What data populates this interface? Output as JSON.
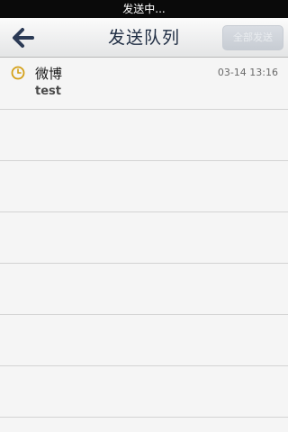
{
  "status_bar": {
    "text": "发送中..."
  },
  "nav_bar": {
    "title": "发送队列",
    "back_icon": "back-arrow-icon",
    "send_all_label": "全部发送"
  },
  "queue": {
    "items": [
      {
        "icon": "clock-icon",
        "title": "微博",
        "subtitle": "test",
        "time": "03-14 13:16"
      }
    ]
  },
  "colors": {
    "status_bar_bg": "#0a0a0a",
    "nav_title": "#1e2c42",
    "clock_icon": "#d4a017",
    "separator": "#d3d3d3"
  }
}
